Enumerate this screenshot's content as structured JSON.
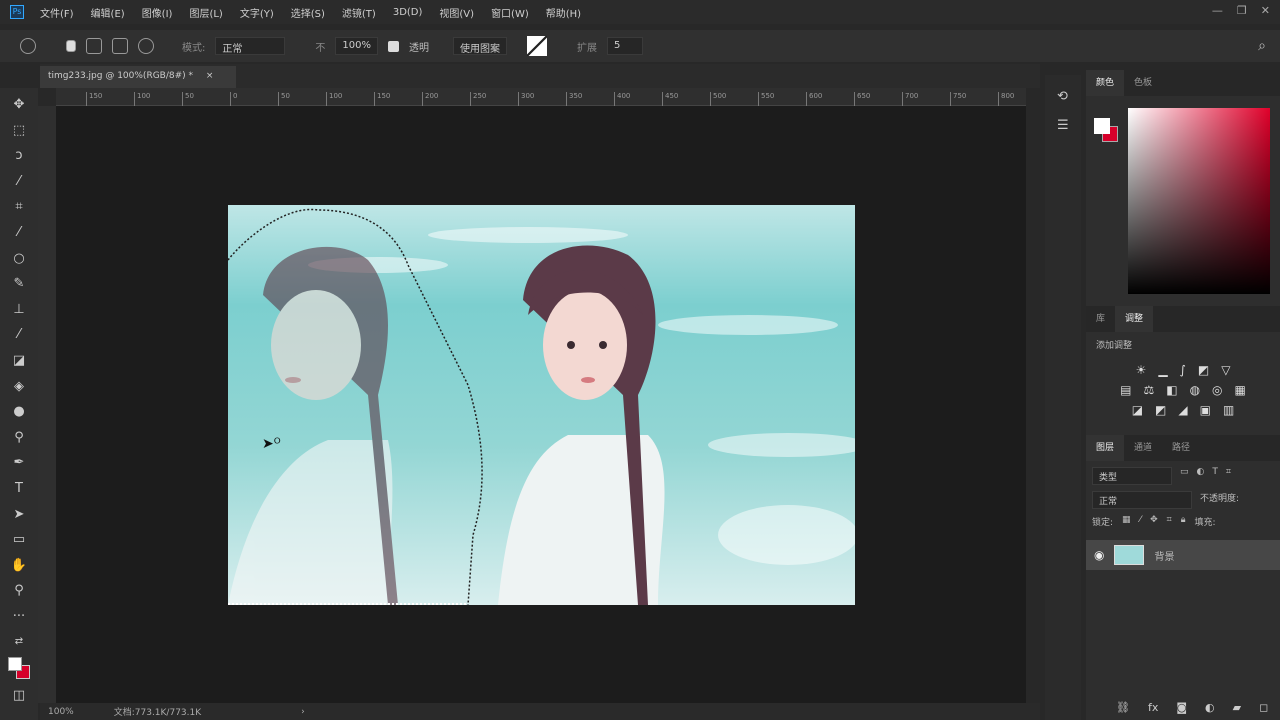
{
  "app": {
    "logo": "Ps"
  },
  "menu": [
    "文件(F)",
    "编辑(E)",
    "图像(I)",
    "图层(L)",
    "文字(Y)",
    "选择(S)",
    "滤镜(T)",
    "3D(D)",
    "视图(V)",
    "窗口(W)",
    "帮助(H)"
  ],
  "options": {
    "mode_label": "模式:",
    "mode_value": "正常",
    "opacity_label": "不",
    "opacity_value": "100%",
    "checkbox_label": "透明",
    "button_label": "使用图案",
    "extra_label": "扩展",
    "extra_value": "5"
  },
  "document": {
    "tab_title": "timg233.jpg @ 100%(RGB/8#) *",
    "close": "×"
  },
  "ruler": [
    "150",
    "100",
    "50",
    "0",
    "50",
    "100",
    "150",
    "200",
    "250",
    "300",
    "350",
    "400",
    "450",
    "500",
    "550",
    "600",
    "650",
    "700",
    "750",
    "800"
  ],
  "status": {
    "zoom": "100%",
    "doc": "文档:773.1K/773.1K",
    "arrow": "›"
  },
  "panels": {
    "color_tabs": [
      "颜色",
      "色板"
    ],
    "adjust_tabs": [
      "库",
      "调整"
    ],
    "adjust_title": "添加调整",
    "layers_tabs": [
      "图层",
      "通道",
      "路径"
    ],
    "kind": "类型",
    "blend": "正常",
    "opacity": "不透明度:",
    "lock": "锁定:",
    "fill": "填充:",
    "layer_name": "背景"
  },
  "colors": {
    "foreground": "#ffffff",
    "background": "#d6002a",
    "accent": "#e0002a"
  }
}
